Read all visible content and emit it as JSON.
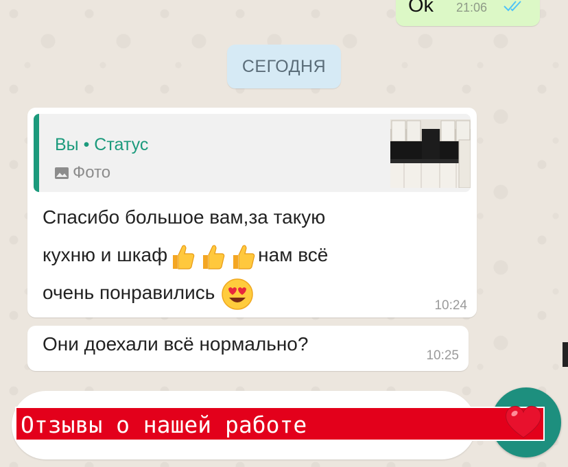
{
  "chat": {
    "outgoing_message": {
      "text": "Ok",
      "time": "21:06",
      "status_icon": "double-check-icon"
    },
    "date_separator": "СЕГОДНЯ",
    "message_1": {
      "quote": {
        "title": "Вы • Статус",
        "media_label": "Фото",
        "media_icon": "photo-icon",
        "thumbnail": "kitchen-photo-thumbnail"
      },
      "line_1": "Спасибо большое вам,за такую",
      "line_2_start": "кухню и шкаф",
      "line_2_end": "нам всё",
      "line_3": "очень понравились",
      "emojis": [
        "thumbs-up-icon",
        "thumbs-up-icon",
        "thumbs-up-icon",
        "heart-eyes-emoji-icon"
      ],
      "time": "10:24"
    },
    "message_2": {
      "text": "Они доехали всё нормально?",
      "time": "10:25"
    }
  },
  "promo": {
    "text": "Отзывы о нашей работе",
    "icon": "red-heart-icon"
  },
  "colors": {
    "accent": "#1b9a7c",
    "outgoing_bubble": "#dcf8c6",
    "date_chip": "#d6eaf5",
    "banner": "#e3001b",
    "send_button": "#1d8f7e"
  }
}
